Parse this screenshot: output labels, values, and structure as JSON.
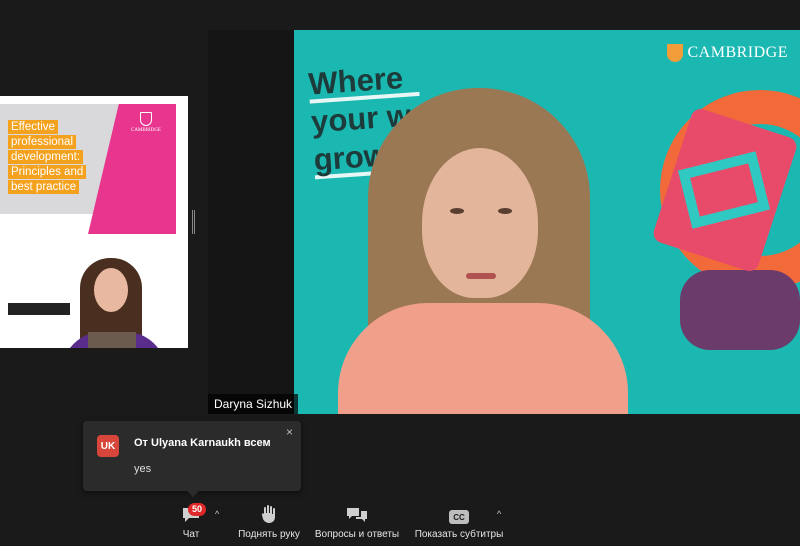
{
  "shared_screen": {
    "title_lines": [
      "Effective",
      "professional",
      "development:",
      "Principles and",
      "best practice"
    ],
    "publisher": "CAMBRIDGE"
  },
  "video": {
    "tagline": [
      "Where",
      "your world",
      "grows"
    ],
    "brand": "CAMBRIDGE",
    "participant_name": "Daryna Sizhuk"
  },
  "chat_notification": {
    "avatar_initials": "UK",
    "from": "От Ulyana Karnaukh всем",
    "message": "yes",
    "close_symbol": "×"
  },
  "toolbar": {
    "chat": {
      "label": "Чат",
      "badge": "50"
    },
    "raise_hand": {
      "label": "Поднять руку"
    },
    "qa": {
      "label": "Вопросы и ответы"
    },
    "captions": {
      "label": "Показать субтитры",
      "icon_text": "CC"
    },
    "caret_symbol": "^"
  }
}
